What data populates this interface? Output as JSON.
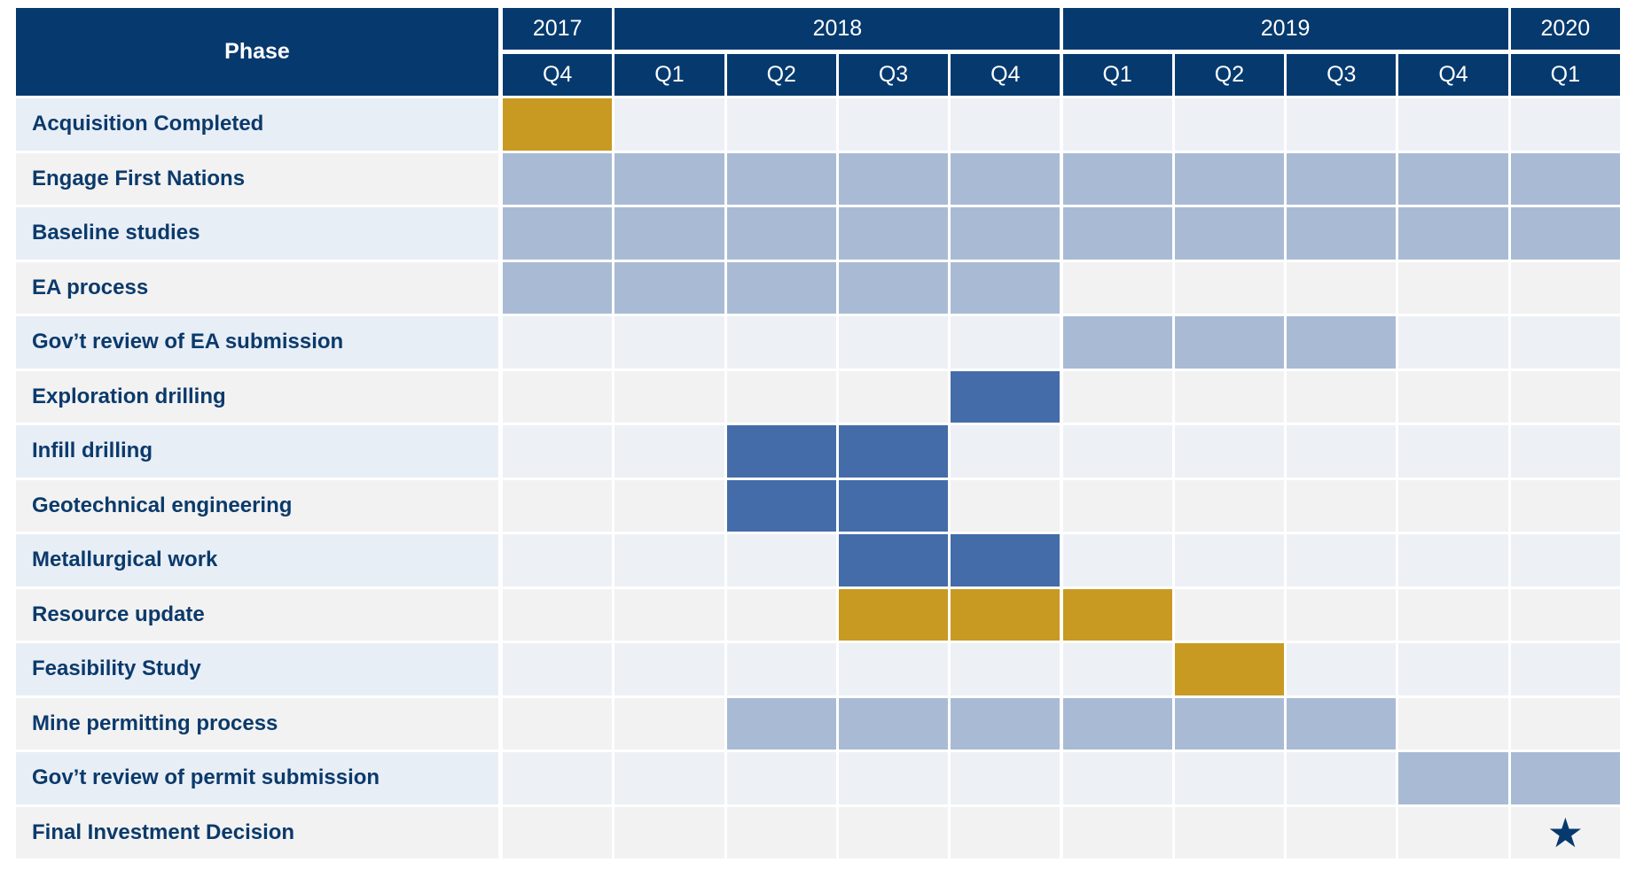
{
  "chart_data": {
    "type": "table",
    "phase_header": "Phase",
    "years": [
      {
        "label": "2017",
        "span": 1
      },
      {
        "label": "2018",
        "span": 4
      },
      {
        "label": "2019",
        "span": 4
      },
      {
        "label": "2020",
        "span": 1
      }
    ],
    "quarters": [
      "Q4",
      "Q1",
      "Q2",
      "Q3",
      "Q4",
      "Q1",
      "Q2",
      "Q3",
      "Q4",
      "Q1"
    ],
    "colors": {
      "header": "#063a6e",
      "light_bar": "#a9bbd4",
      "dark_bar": "#446ca9",
      "gold_bar": "#c99a22",
      "row_a": "#e8eef6",
      "row_b": "#f2f2f2",
      "text": "#0b3a6b"
    },
    "rows": [
      {
        "phase": "Acquisition Completed",
        "start": 0,
        "end": 0,
        "style": "gold_bar"
      },
      {
        "phase": "Engage First Nations",
        "start": 0,
        "end": 9,
        "style": "light_bar"
      },
      {
        "phase": "Baseline studies",
        "start": 0,
        "end": 9,
        "style": "light_bar"
      },
      {
        "phase": "EA process",
        "start": 0,
        "end": 4,
        "style": "light_bar"
      },
      {
        "phase": "Gov’t review of EA submission",
        "start": 5,
        "end": 7,
        "style": "light_bar"
      },
      {
        "phase": "Exploration drilling",
        "start": 4,
        "end": 4,
        "style": "dark_bar"
      },
      {
        "phase": "Infill drilling",
        "start": 2,
        "end": 3,
        "style": "dark_bar"
      },
      {
        "phase": "Geotechnical engineering",
        "start": 2,
        "end": 3,
        "style": "dark_bar"
      },
      {
        "phase": "Metallurgical work",
        "start": 3,
        "end": 4,
        "style": "dark_bar"
      },
      {
        "phase": "Resource update",
        "start": 3,
        "end": 5,
        "style": "gold_bar"
      },
      {
        "phase": "Feasibility Study",
        "start": 6,
        "end": 6,
        "style": "gold_bar"
      },
      {
        "phase": "Mine permitting process",
        "start": 2,
        "end": 7,
        "style": "light_bar"
      },
      {
        "phase": "Gov’t review of permit submission",
        "start": 8,
        "end": 9,
        "style": "light_bar"
      },
      {
        "phase": "Final Investment Decision",
        "milestone": 9,
        "marker": "star-icon"
      }
    ]
  }
}
